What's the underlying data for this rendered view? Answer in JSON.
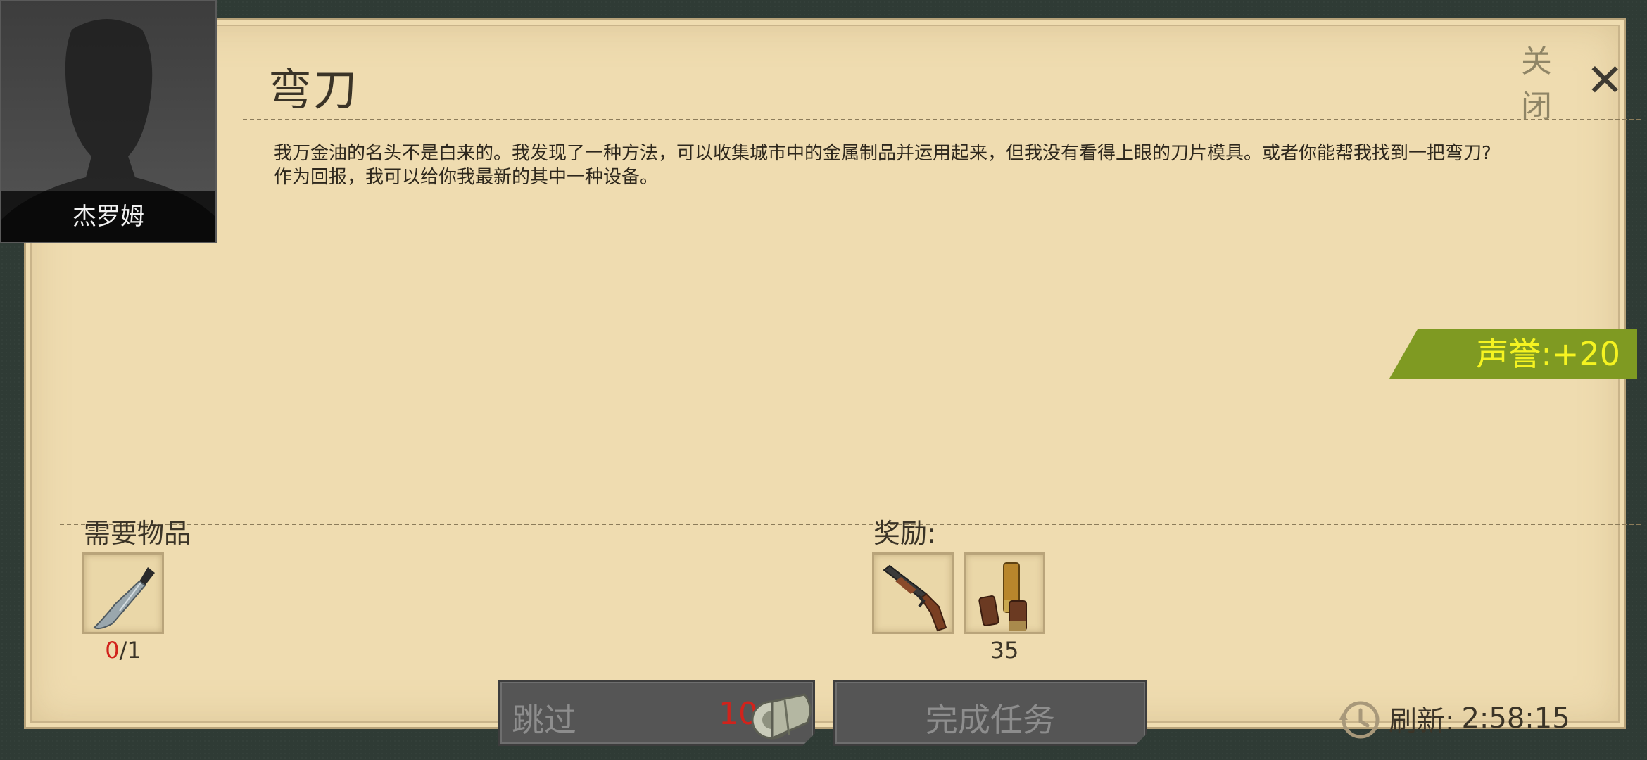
{
  "quest": {
    "title": "弯刀",
    "close_label": "关闭",
    "description_lines": [
      "我万金油的名头不是白来的。我发现了一种方法，可以收集城市中的金属制品并运用起来，但我没有看得上眼的刀片模具。或者你能帮我找到一把弯刀?",
      "作为回报，我可以给你我最新的其中一种设备。"
    ],
    "reputation": "声誉:+20"
  },
  "npc": {
    "name": "杰罗姆"
  },
  "required": {
    "label": "需要物品",
    "item": {
      "icon": "machete-icon",
      "have": "0",
      "need": "/1"
    }
  },
  "rewards": {
    "label": "奖励:",
    "items": [
      {
        "icon": "shotgun-icon",
        "count": ""
      },
      {
        "icon": "shotgun-shells-icon",
        "count": "35"
      }
    ]
  },
  "actions": {
    "skip_label": "跳过",
    "skip_cost": "10",
    "complete_label": "完成任务"
  },
  "refresh": {
    "label": "刷新:",
    "time": "2:58:15"
  },
  "colors": {
    "reputation_bg": "#7f9a22",
    "reputation_text": "#f5f321",
    "alert": "#d1231c"
  }
}
